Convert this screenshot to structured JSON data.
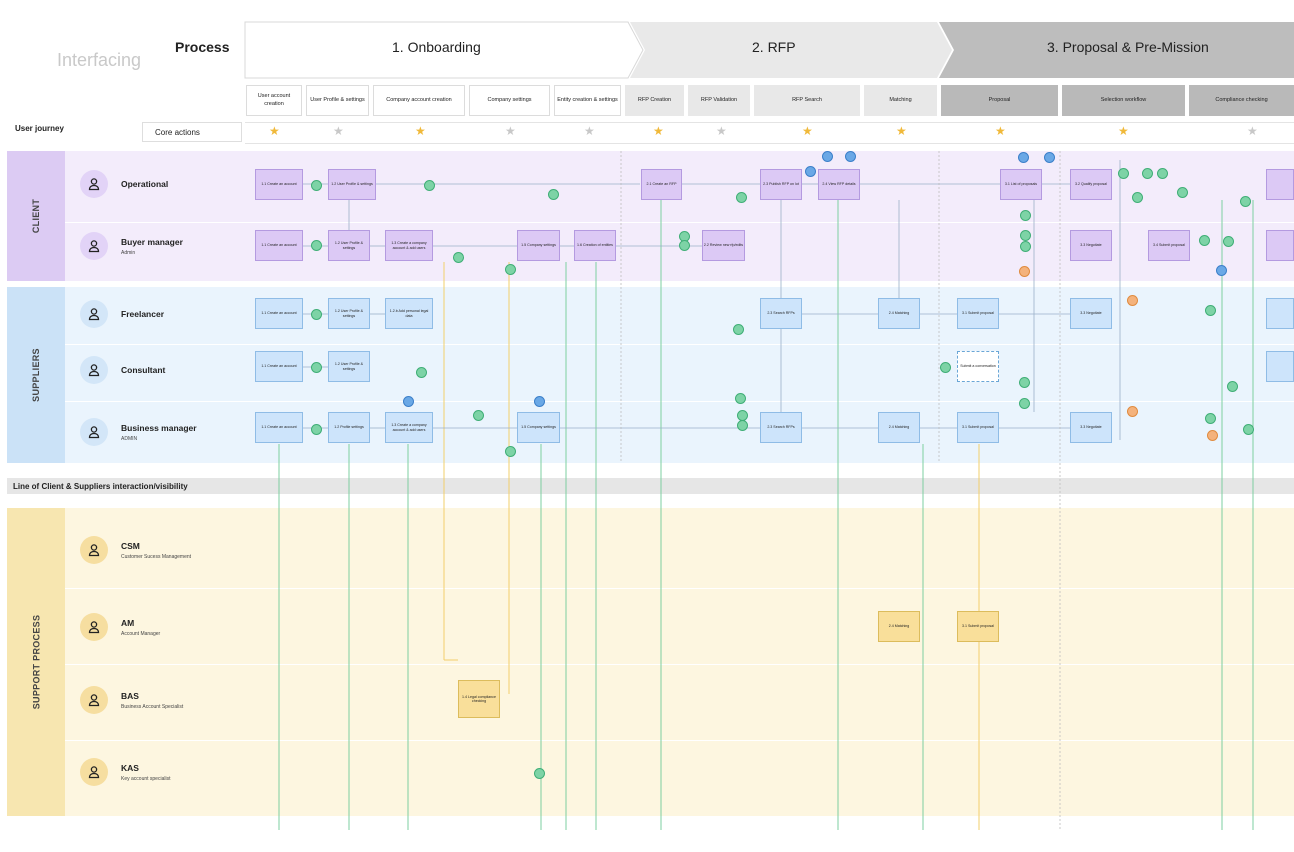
{
  "header": {
    "interfacing": "Interfacing",
    "process_label": "Process",
    "phases": [
      "1. Onboarding",
      "2. RFP",
      "3. Proposal & Pre-Mission"
    ]
  },
  "sub_steps": [
    {
      "label": "User account creation",
      "tone": "white"
    },
    {
      "label": "User Profile & settings",
      "tone": "white"
    },
    {
      "label": "Company account creation",
      "tone": "white"
    },
    {
      "label": "Company settings",
      "tone": "white"
    },
    {
      "label": "Entity creation & settings",
      "tone": "white"
    },
    {
      "label": "RFP Creation",
      "tone": "grey"
    },
    {
      "label": "RFP Validation",
      "tone": "grey"
    },
    {
      "label": "RFP Search",
      "tone": "grey"
    },
    {
      "label": "Matching",
      "tone": "grey"
    },
    {
      "label": "Proposal",
      "tone": "dark"
    },
    {
      "label": "Selection workflow",
      "tone": "dark"
    },
    {
      "label": "Compliance checking",
      "tone": "dark"
    }
  ],
  "journey": {
    "user_journey_label": "User journey",
    "core_actions_label": "Core actions",
    "stars": [
      "gold",
      "grey",
      "gold",
      "grey",
      "grey",
      "gold",
      "grey",
      "gold",
      "gold",
      "gold",
      "gold",
      "grey"
    ]
  },
  "lanes": {
    "client": {
      "label": "CLIENT",
      "roles": [
        {
          "name": "Operational",
          "sub": ""
        },
        {
          "name": "Buyer manager",
          "sub": "Admin"
        }
      ]
    },
    "suppliers": {
      "label": "SUPPLIERS",
      "roles": [
        {
          "name": "Freelancer",
          "sub": ""
        },
        {
          "name": "Consultant",
          "sub": ""
        },
        {
          "name": "Business manager",
          "sub": "ADMIN"
        }
      ]
    },
    "support": {
      "label": "SUPPORT PROCESS",
      "roles": [
        {
          "name": "CSM",
          "sub": "Customer Sucess Management"
        },
        {
          "name": "AM",
          "sub": "Account Manager"
        },
        {
          "name": "BAS",
          "sub": "Business Account Specialist"
        },
        {
          "name": "KAS",
          "sub": "Key account specialist"
        }
      ]
    }
  },
  "line_of_interaction": "Line of Client & Suppliers interaction/visibility",
  "boxes": {
    "op_create_account": "1.1 Create an account",
    "op_user_profile": "1.2 User Profile & settings",
    "op_create_rfp": "2.1 Create an RFP",
    "op_publish_rfp": "2.3 Publish RFP on lot",
    "op_view_rfp": "2.4 View RFP details",
    "op_list_proposals": "3.1 List of proposals",
    "op_qualify": "3.2 Qualify proposal",
    "bm_create_account": "1.1 Create an account",
    "bm_user_profile": "1.2 User Profile & settings",
    "bm_company_account": "1.3 Create a company account & add users",
    "bm_company_settings": "1.5 Company settings",
    "bm_creation_entities": "1.6 Creation of entities",
    "bm_review_rfp": "2.2 Review new rfp/edits",
    "bm_negotiate": "3.3 Negotiate",
    "bm_submit": "3.4 Submit proposal",
    "fr_create_account": "1.1 Create an account",
    "fr_user_profile": "1.2 User Profile & settings",
    "fr_add_personal": "1.2.b Add personal legal data",
    "fr_search_rfp": "2.3 Search RFPs",
    "fr_matching": "2.4 Matching",
    "fr_submit": "3.1 Submit proposal",
    "fr_negotiate": "3.3 Negotiate",
    "co_create_account": "1.1 Create an account",
    "co_user_profile": "1.2 User Profile & settings",
    "co_submit_conv": "Submit a conversation",
    "bs_create_account": "1.1 Create an account",
    "bs_profile": "1.2 Profile settings",
    "bs_company_account": "1.3 Create a company account & add users",
    "bs_company_settings": "1.5 Company settings",
    "bs_search_rfp": "2.3 Search RFPs",
    "bs_matching": "2.4 Matching",
    "bs_submit": "3.1 Submit proposal",
    "bs_negotiate": "3.3 Negotiate",
    "am_matching": "2.4 Matching",
    "am_submit": "3.1 Submit proposal",
    "bas_compliance": "1.4 Legal compliance checking"
  },
  "colors": {
    "client_bg": "#f3ecfb",
    "client_box": "#dcc9f5",
    "supplier_bg": "#eaf4fd",
    "supplier_box": "#cde4fb",
    "support_bg": "#fdf6e0",
    "support_box": "#f9df9a",
    "gold_star": "#f0b93a",
    "grey_star": "#c8c8c8",
    "green_line": "#7dcfa0",
    "yellow_line": "#f2cf6b"
  }
}
